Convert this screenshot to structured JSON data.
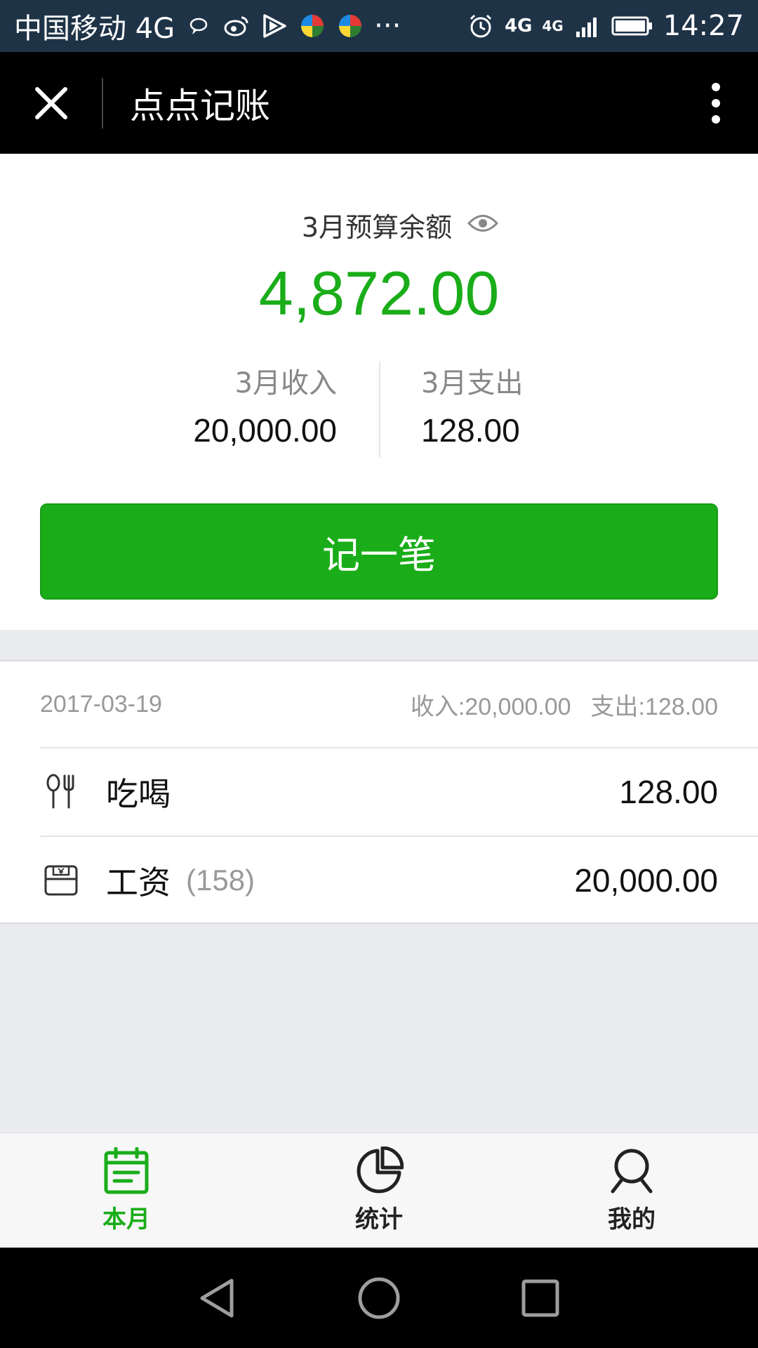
{
  "status_bar": {
    "carrier": "中国移动 4G",
    "more": "···",
    "time": "14:27",
    "network_left": "4G",
    "network_right": "4G"
  },
  "header": {
    "title": "点点记账"
  },
  "summary": {
    "budget_label": "3月预算余额",
    "budget_amount": "4,872.00",
    "income_label": "3月收入",
    "income_value": "20,000.00",
    "expense_label": "3月支出",
    "expense_value": "128.00",
    "record_button": "记一笔"
  },
  "list": {
    "date": "2017-03-19",
    "income_total": "收入:20,000.00",
    "expense_total": "支出:128.00",
    "entries": [
      {
        "icon": "fork-knife-icon",
        "name": "吃喝",
        "count": "",
        "amount": "128.00"
      },
      {
        "icon": "wallet-yuan-icon",
        "name": "工资",
        "count": "(158)",
        "amount": "20,000.00"
      }
    ]
  },
  "tabs": [
    {
      "label": "本月",
      "icon": "calendar-icon",
      "active": true
    },
    {
      "label": "统计",
      "icon": "pie-chart-icon",
      "active": false
    },
    {
      "label": "我的",
      "icon": "user-icon",
      "active": false
    }
  ],
  "colors": {
    "accent": "#1aad19",
    "status_bar": "#1f3347",
    "header": "#000000"
  }
}
